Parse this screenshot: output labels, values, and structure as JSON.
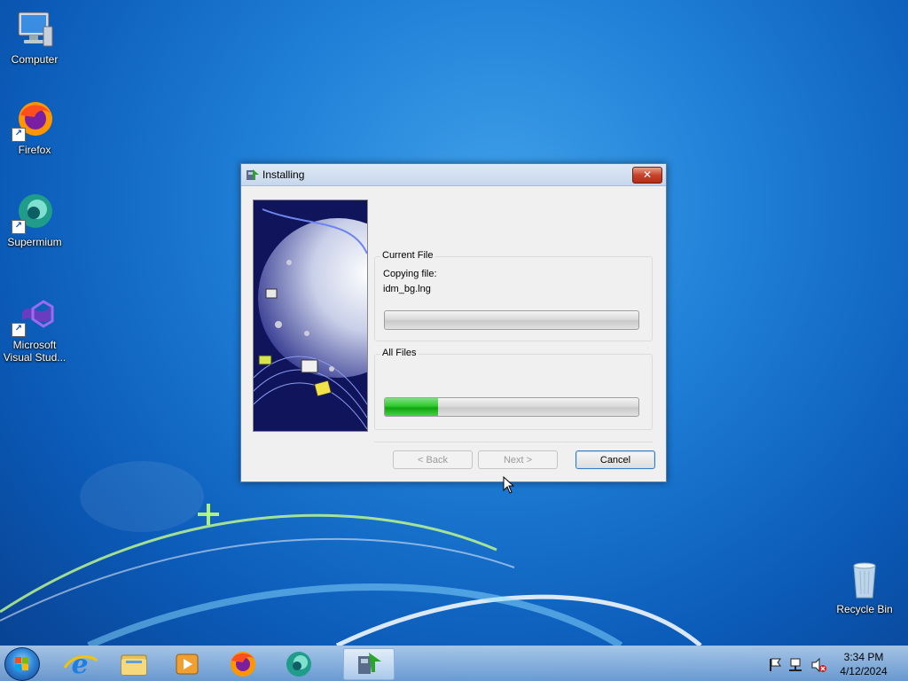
{
  "desktop": {
    "icons": [
      {
        "label": "Computer"
      },
      {
        "label": "Firefox"
      },
      {
        "label": "Supermium"
      },
      {
        "label": "Microsoft Visual Stud..."
      },
      {
        "label": "Recycle Bin"
      }
    ],
    "shortcut_glyph": "↗"
  },
  "dialog": {
    "title": "Installing",
    "close_glyph": "✕",
    "current_file": {
      "group_title": "Current File",
      "action_text": "Copying file:",
      "file_name": "idm_bg.lng",
      "progress": 0
    },
    "all_files": {
      "group_title": "All Files",
      "progress": 0.21
    },
    "buttons": {
      "back": "< Back",
      "next": "Next >",
      "cancel": "Cancel"
    }
  },
  "taskbar": {
    "items": [
      "Start",
      "Internet Explorer",
      "Windows Explorer",
      "Windows Media Player",
      "Firefox",
      "Supermium",
      "Installing"
    ],
    "clock": {
      "time": "3:34 PM",
      "date": "4/12/2024"
    }
  },
  "colors": {
    "progress_green": "#2ec92e",
    "close_red": "#c7432b",
    "desktop_blue": "#1f7fd6"
  }
}
